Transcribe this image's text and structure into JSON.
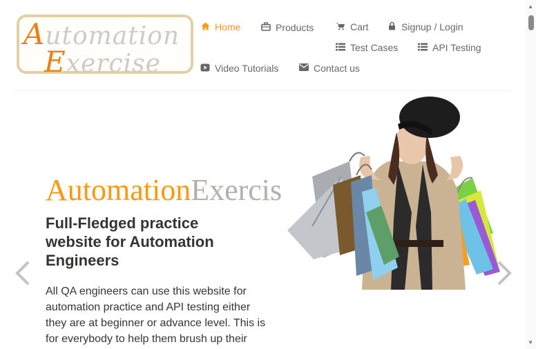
{
  "logo": {
    "line1_cap": "A",
    "line1_rest": "utomation",
    "line2_cap": "E",
    "line2_rest": "xercise"
  },
  "nav": {
    "home": "Home",
    "products": "Products",
    "cart": "Cart",
    "signup": "Signup / Login",
    "test_cases": "Test Cases",
    "api_testing": "API Testing",
    "video_tutorials": "Video Tutorials",
    "contact": "Contact us"
  },
  "hero": {
    "brand_part1": "Automation",
    "brand_part2": "Exercise",
    "heading": "Full-Fledged practice website for Automation Engineers",
    "text": "All QA engineers can use this website for automation practice and API testing either they are at beginner or advance level. This is for everybody to help them brush up their"
  },
  "colors": {
    "accent": "#fe980f",
    "text": "#696763",
    "heading": "#363432"
  },
  "icons": {
    "home": "home-icon",
    "products": "briefcase-icon",
    "cart": "cart-icon",
    "signup": "lock-icon",
    "test_cases": "list-icon",
    "api_testing": "list-icon",
    "video": "youtube-play-icon",
    "contact": "envelope-icon"
  }
}
